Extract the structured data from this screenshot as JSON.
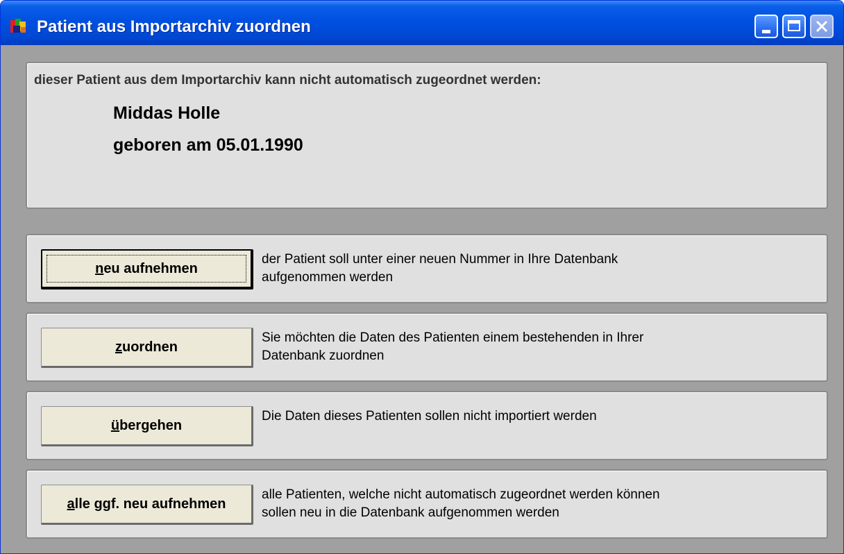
{
  "window": {
    "title": "Patient aus Importarchiv zuordnen",
    "icon": "app-icon",
    "controls": [
      "minimize-icon",
      "maximize-icon",
      "close-icon"
    ]
  },
  "info": {
    "heading": "dieser Patient aus dem Importarchiv kann nicht automatisch zugeordnet werden:",
    "patient_name": "Middas Holle",
    "patient_dob": "geboren am 05.01.1990"
  },
  "actions": [
    {
      "button_mnemonic": "n",
      "button_rest": "eu aufnehmen",
      "description_line1": "der Patient soll unter einer neuen Nummer in Ihre Datenbank",
      "description_line2": "aufgenommen werden"
    },
    {
      "button_mnemonic": "z",
      "button_rest": "uordnen",
      "description_line1": "Sie möchten die Daten des Patienten einem bestehenden in Ihrer",
      "description_line2": "Datenbank zuordnen"
    },
    {
      "button_mnemonic": "ü",
      "button_rest": "bergehen",
      "description_line1": "Die Daten dieses Patienten sollen nicht importiert werden",
      "description_line2": ""
    },
    {
      "button_mnemonic": "a",
      "button_rest": "lle ggf. neu aufnehmen",
      "description_line1": "alle Patienten, welche nicht automatisch zugeordnet werden können",
      "description_line2": "sollen neu in die Datenbank aufgenommen werden"
    }
  ],
  "colors": {
    "titlebar": "#0050e0",
    "dialog_bg": "#a0a0a0",
    "panel_bg": "#e0e0e0",
    "button_bg": "#ece9d8"
  }
}
